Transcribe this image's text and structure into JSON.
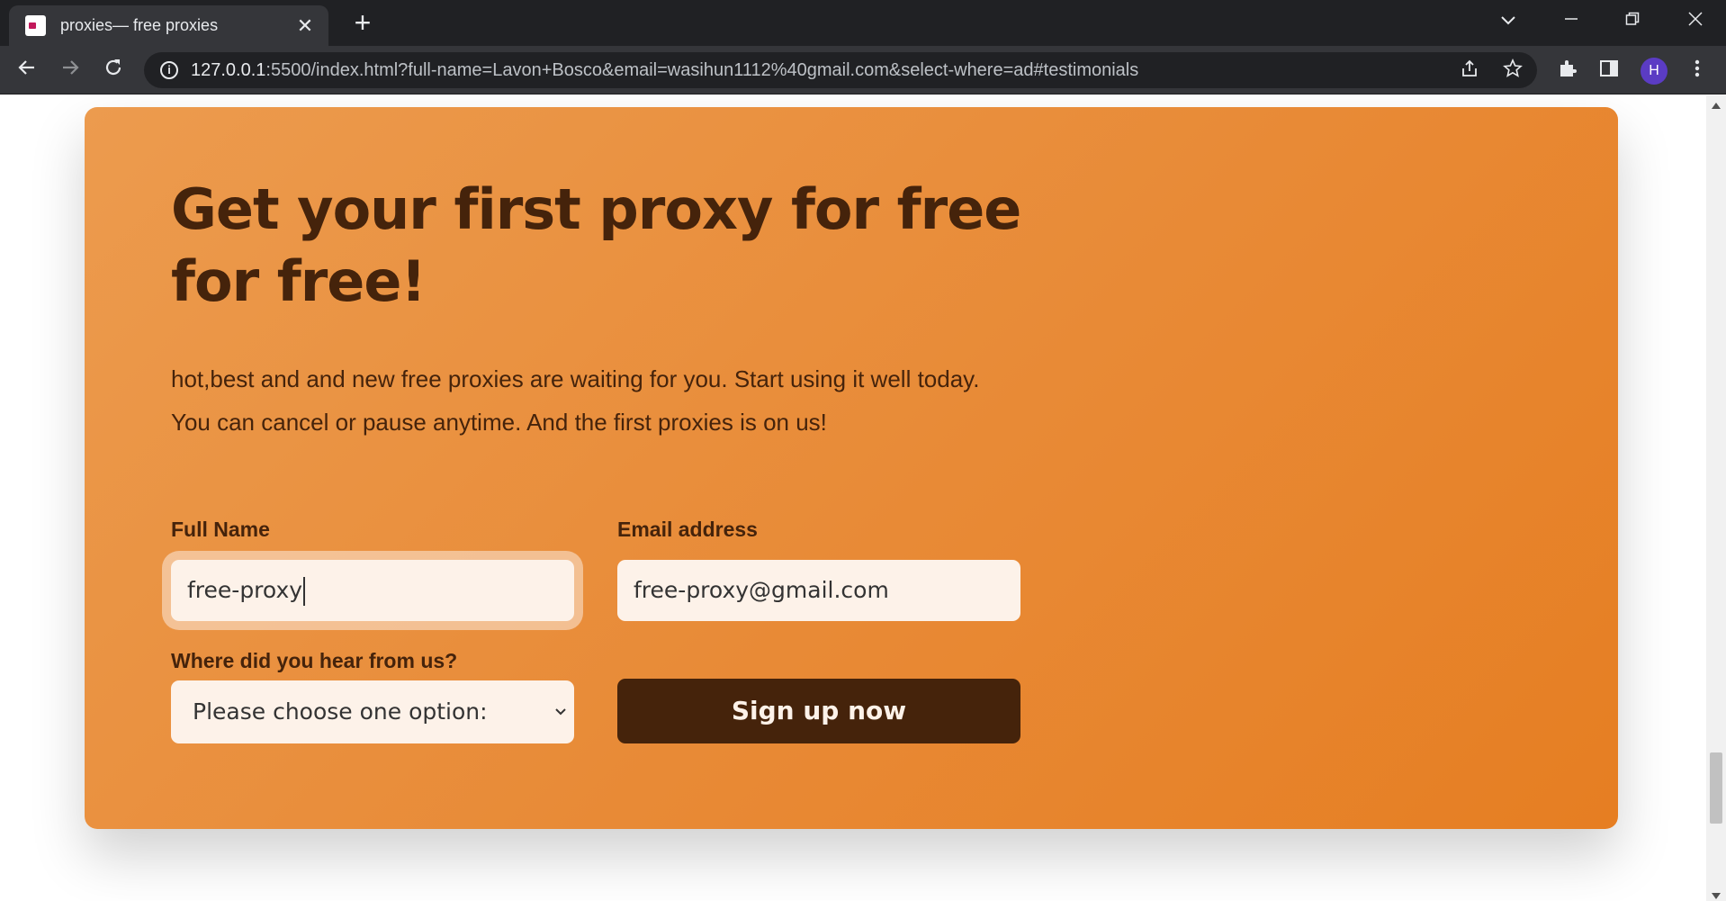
{
  "browser": {
    "tab_title": "proxies— free proxies",
    "tab_close": "✕",
    "new_tab": "+",
    "url_host": "127.0.0.1",
    "url_rest": ":5500/index.html?full-name=Lavon+Bosco&email=wasihun1112%40gmail.com&select-where=ad#testimonials",
    "profile_initial": "H"
  },
  "cta": {
    "heading": "Get your first proxy for free for free!",
    "description": "hot,best and and new free proxies are waiting for you. Start using it well today. You can cancel or pause anytime. And the first proxies is on us!",
    "form": {
      "full_name_label": "Full Name",
      "full_name_value": "free-proxy",
      "email_label": "Email address",
      "email_value": "free-proxy@gmail.com",
      "source_label": "Where did you hear from us?",
      "source_selected": "Please choose one option:",
      "submit_label": "Sign up now"
    }
  },
  "colors": {
    "card_start": "#ec9b4e",
    "card_end": "#e67e22",
    "text_dark": "#45230b",
    "input_bg": "#fdf2e9"
  }
}
